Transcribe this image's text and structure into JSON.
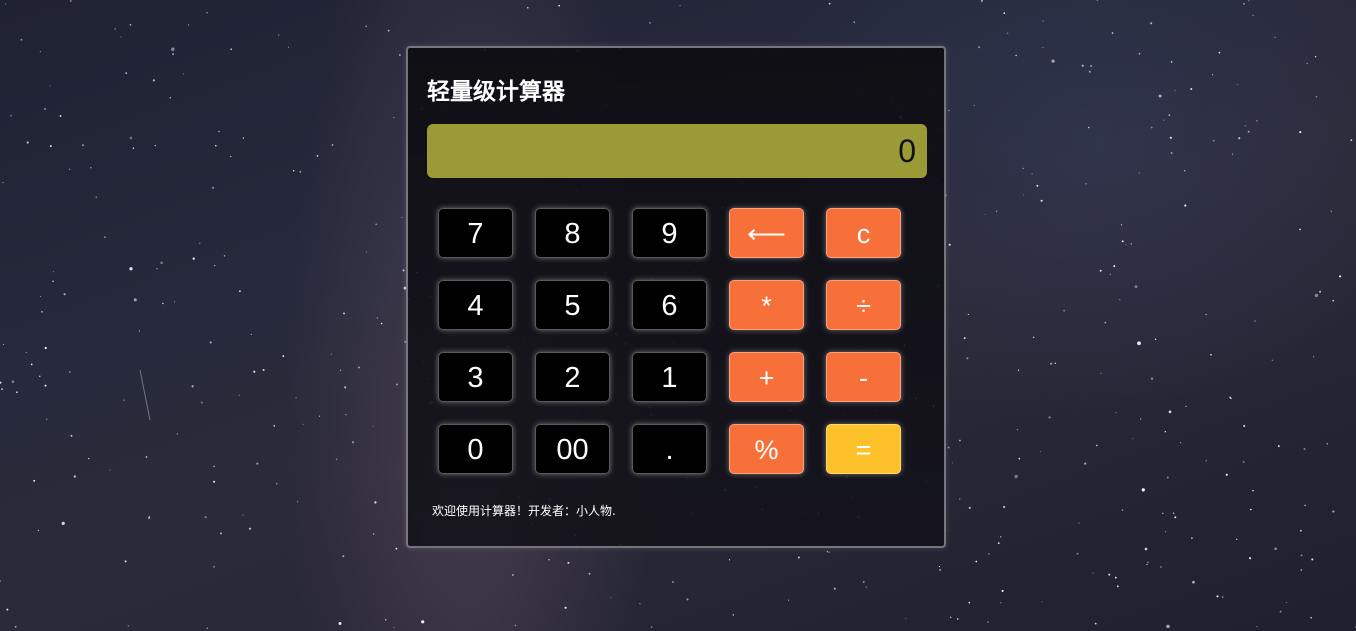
{
  "app": {
    "title": "轻量级计算器",
    "display_value": "0",
    "footer_text": "欢迎使用计算器！开发者：小人物."
  },
  "keypad": {
    "rows": [
      [
        {
          "label": "7",
          "kind": "number",
          "name": "key-7"
        },
        {
          "label": "8",
          "kind": "number",
          "name": "key-8"
        },
        {
          "label": "9",
          "kind": "number",
          "name": "key-9"
        },
        {
          "label": "⟵",
          "kind": "operator",
          "name": "backspace-button"
        },
        {
          "label": "c",
          "kind": "operator",
          "name": "clear-button"
        }
      ],
      [
        {
          "label": "4",
          "kind": "number",
          "name": "key-4"
        },
        {
          "label": "5",
          "kind": "number",
          "name": "key-5"
        },
        {
          "label": "6",
          "kind": "number",
          "name": "key-6"
        },
        {
          "label": "*",
          "kind": "operator",
          "name": "multiply-button"
        },
        {
          "label": "÷",
          "kind": "operator",
          "name": "divide-button"
        }
      ],
      [
        {
          "label": "3",
          "kind": "number",
          "name": "key-3"
        },
        {
          "label": "2",
          "kind": "number",
          "name": "key-2"
        },
        {
          "label": "1",
          "kind": "number",
          "name": "key-1"
        },
        {
          "label": "+",
          "kind": "operator",
          "name": "plus-button"
        },
        {
          "label": "-",
          "kind": "operator",
          "name": "minus-button"
        }
      ],
      [
        {
          "label": "0",
          "kind": "number",
          "name": "key-0"
        },
        {
          "label": "00",
          "kind": "number",
          "name": "key-00"
        },
        {
          "label": ".",
          "kind": "number",
          "name": "key-decimal"
        },
        {
          "label": "%",
          "kind": "operator",
          "name": "percent-button"
        },
        {
          "label": "=",
          "kind": "equals",
          "name": "equals-button"
        }
      ]
    ]
  },
  "colors": {
    "display_background": "#9c9a37",
    "number_key": "#000000",
    "operator_key": "#f7703a",
    "equals_key": "#fec12a",
    "panel_background": "#141319"
  }
}
